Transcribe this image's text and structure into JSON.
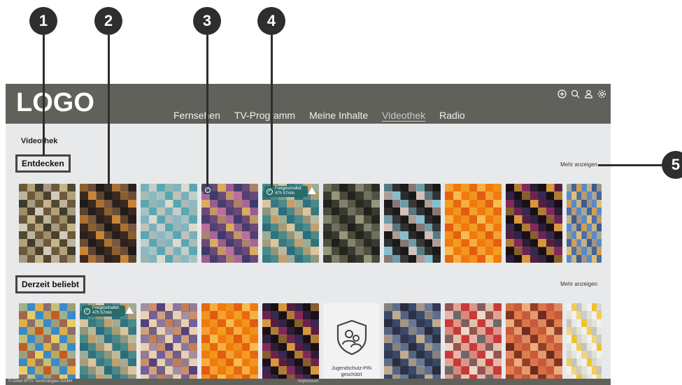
{
  "callouts": [
    "1",
    "2",
    "3",
    "4",
    "5"
  ],
  "header": {
    "logo": "LOGO",
    "nav": [
      "Fernsehen",
      "TV-Programm",
      "Meine Inhalte",
      "Videothek",
      "Radio"
    ],
    "active_nav": "Videothek",
    "icons": [
      "add-circle-icon",
      "search-icon",
      "user-icon",
      "settings-icon"
    ]
  },
  "page": {
    "title": "Videothek"
  },
  "sections": [
    {
      "title": "Entdecken",
      "more": "Mehr anzeigen",
      "tiles": [
        {
          "colors": [
            "#6b5a3a",
            "#c9b98f",
            "#3d3a2a",
            "#d8d2c2"
          ]
        },
        {
          "colors": [
            "#3a2a22",
            "#d08a3a",
            "#7a5a40",
            "#1e1a18"
          ]
        },
        {
          "colors": [
            "#5aa6b2",
            "#c6c2b8",
            "#8fb8c2",
            "#e3dccd"
          ]
        },
        {
          "colors": [
            "#6a4a78",
            "#e0b060",
            "#c070a0",
            "#3a3a6a"
          ],
          "badge": "small"
        },
        {
          "colors": [
            "#4a8a8a",
            "#c8a070",
            "#e0c8a0",
            "#2a6a7a"
          ],
          "badge": "Freigeschaltet: 47h 57min"
        },
        {
          "colors": [
            "#3a3a30",
            "#9a9a80",
            "#5a5a48",
            "#1e1e1a"
          ]
        },
        {
          "colors": [
            "#1a1a1a",
            "#e0c8c0",
            "#8ac8d8",
            "#3a3a3a"
          ]
        },
        {
          "colors": [
            "#f07a10",
            "#f0a020",
            "#e05a10",
            "#f8c050"
          ]
        },
        {
          "colors": [
            "#1a1018",
            "#e0a040",
            "#8a2a60",
            "#3a2a50"
          ]
        },
        {
          "colors": [
            "#5a8ac8",
            "#e8c070",
            "#3a5a8a",
            "#d8a050"
          ]
        }
      ]
    },
    {
      "title": "Derzeit beliebt",
      "more": "Mehr anzeigen",
      "tiles": [
        {
          "colors": [
            "#3a8ac8",
            "#e8b040",
            "#c85a20",
            "#f0d060"
          ]
        },
        {
          "colors": [
            "#4a8a8a",
            "#c8a070",
            "#e0c8a0",
            "#2a6a7a"
          ],
          "badge": "Freigeschaltet: 47h 57min"
        },
        {
          "colors": [
            "#e8d0b0",
            "#6a5a9a",
            "#c07a50",
            "#4a3a7a"
          ]
        },
        {
          "colors": [
            "#f07a10",
            "#f0a020",
            "#e05a10",
            "#f8c050"
          ]
        },
        {
          "colors": [
            "#1a1018",
            "#e0a040",
            "#8a2a60",
            "#3a2a50"
          ]
        },
        {
          "pin": "Jugendschutz-PIN geschützt"
        },
        {
          "colors": [
            "#3a4a6a",
            "#c8b090",
            "#6a7a9a",
            "#2a2a3a"
          ]
        },
        {
          "colors": [
            "#c83a3a",
            "#f0e0d0",
            "#6a6a6a",
            "#e8c8b0"
          ]
        },
        {
          "colors": [
            "#c85a3a",
            "#f0b080",
            "#6a2a1a",
            "#e08050"
          ]
        },
        {
          "colors": [
            "#f0f0f0",
            "#f0c020",
            "#c0c0c0",
            "#e0e0d0"
          ]
        }
      ]
    }
  ],
  "footer": {
    "copyright": "© Orion IPTV Technologies GmbH",
    "imprint": "Impressum"
  }
}
